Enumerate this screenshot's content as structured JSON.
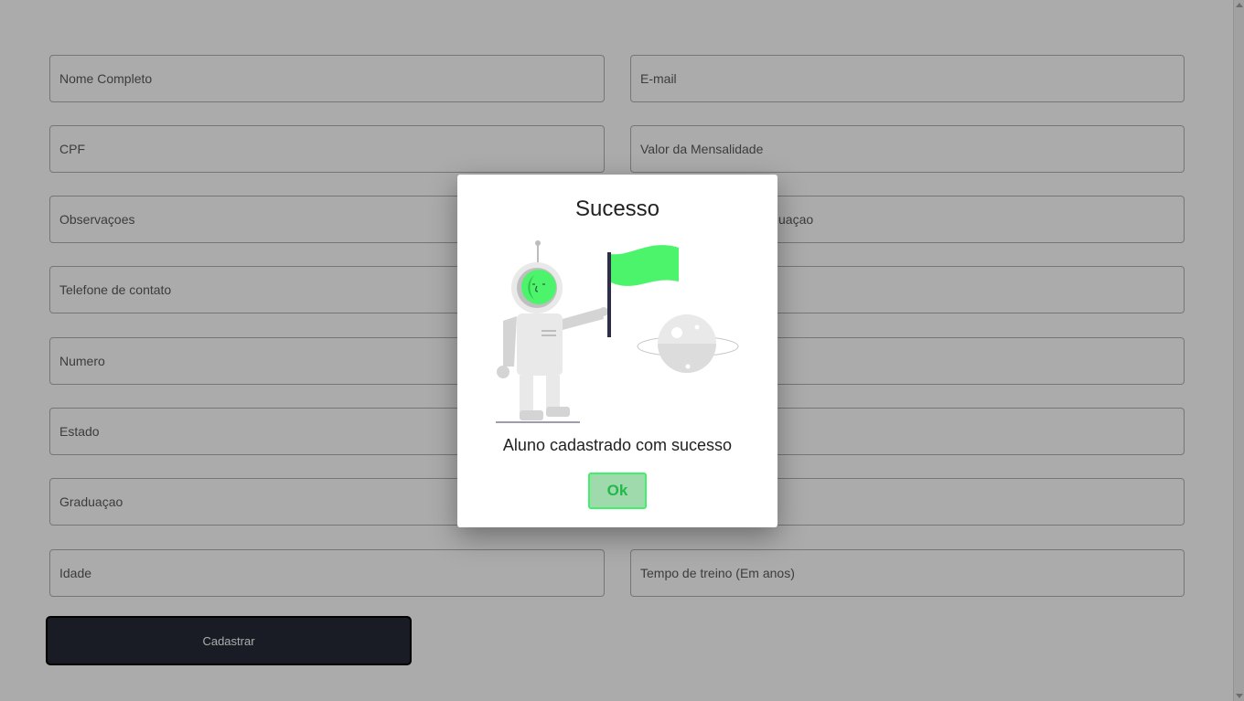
{
  "form": {
    "left_fields": [
      {
        "placeholder": "Nome Completo"
      },
      {
        "placeholder": "CPF"
      },
      {
        "placeholder": "Observaçoes"
      },
      {
        "placeholder": "Telefone de contato"
      },
      {
        "placeholder": "Numero"
      },
      {
        "placeholder": "Estado"
      },
      {
        "placeholder": "Graduaçao"
      },
      {
        "placeholder": "Idade"
      }
    ],
    "right_fields": [
      {
        "placeholder": "E-mail"
      },
      {
        "placeholder": "Valor da Mensalidade"
      },
      {
        "placeholder": "uaçao"
      },
      {
        "placeholder": ""
      },
      {
        "placeholder": ""
      },
      {
        "placeholder": ""
      },
      {
        "placeholder": ""
      },
      {
        "placeholder": "Tempo de treino (Em anos)"
      }
    ],
    "submit_label": "Cadastrar"
  },
  "modal": {
    "title": "Sucesso",
    "message": "Aluno cadastrado com sucesso",
    "ok_label": "Ok",
    "illustration": "astronaut-flag-planet"
  },
  "colors": {
    "accent_green": "#4cf46b",
    "ok_text": "#23b84a",
    "submit_bg": "#262b36",
    "overlay": "rgba(0,0,0,0.33)"
  }
}
